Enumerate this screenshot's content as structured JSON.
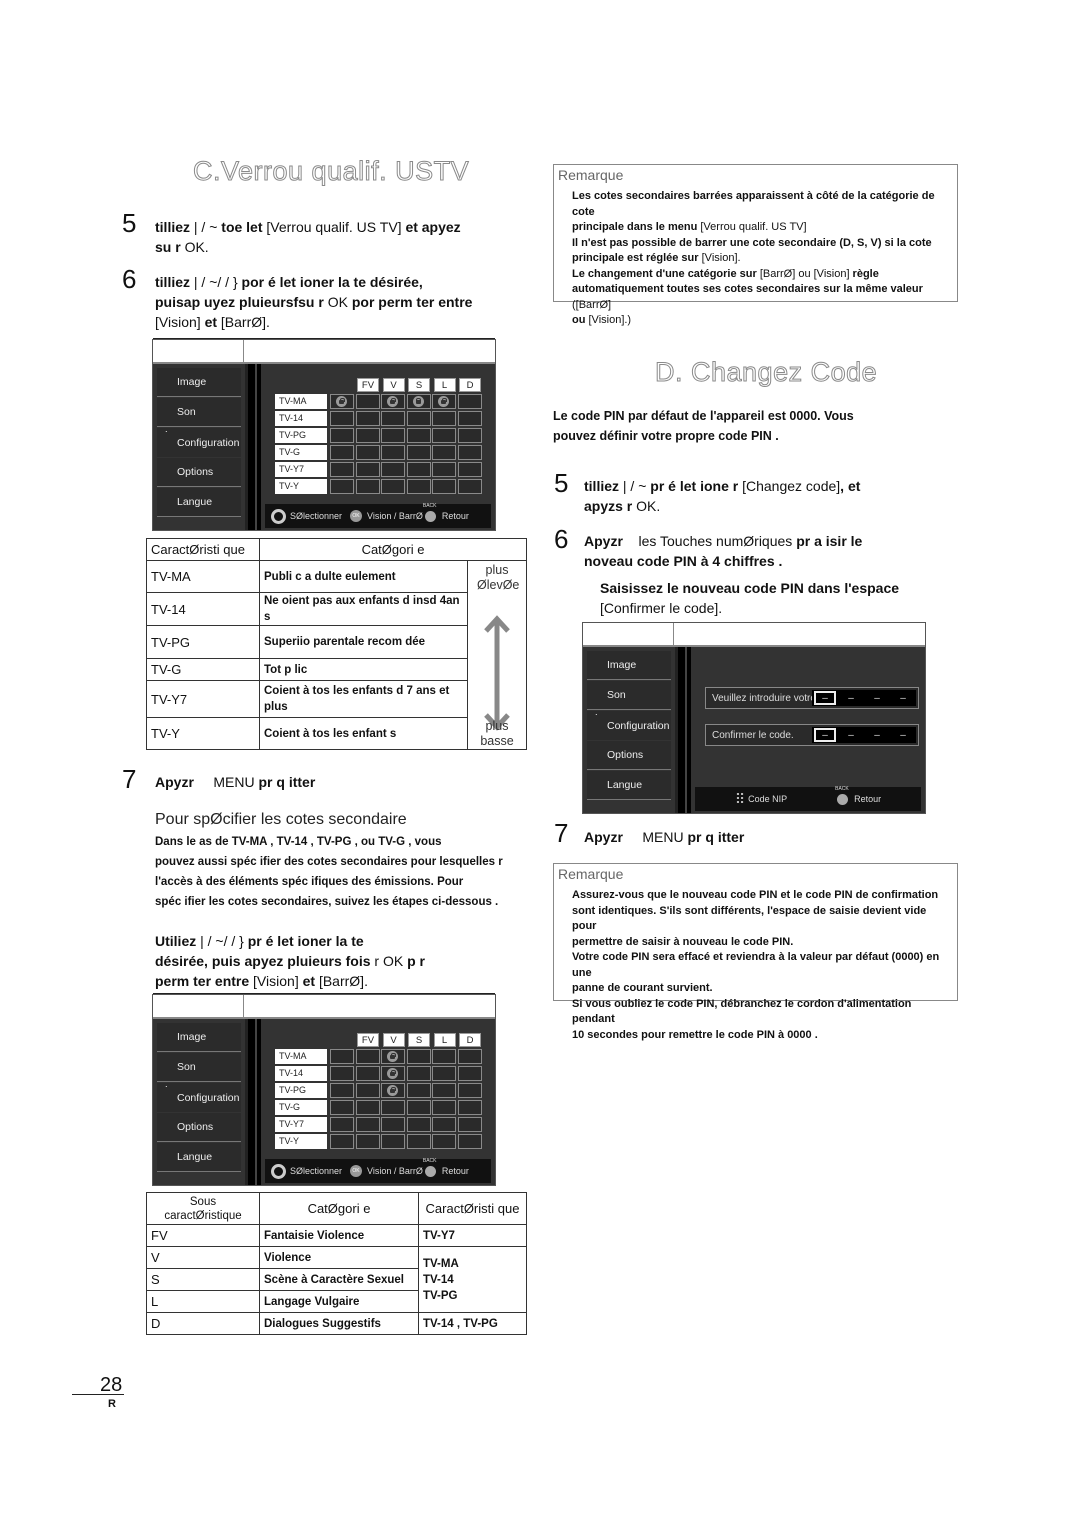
{
  "page": {
    "number": "28",
    "footer_letter": "R"
  },
  "section_c": {
    "title": "C.Verrou qualif. USTV",
    "step5": {
      "num": "5",
      "bold_a": "tilliez",
      "keys": "| / ~",
      "bold_b": "toe let",
      "bracket": "[Verrou qualif. US TV]",
      "bold_c": "et apyez",
      "line2_bold": "su r",
      "line2_reg": "OK."
    },
    "step6": {
      "num": "6",
      "line1_bold_a": "tilliez",
      "line1_keys": "| / ~/ / }",
      "line1_bold_b": "por é let ioner la te désirée,",
      "line2_bold": "puisap uyez pluieursfsu r",
      "line2_reg": "OK",
      "line2_bold_b": "por perm ter entre",
      "line3_reg_a": "[Vision]",
      "line3_bold": "et",
      "line3_reg_b": "[BarrØ]."
    },
    "screen1": {
      "menu": [
        "Image",
        "Son",
        "Configuration",
        "Options",
        "Langue"
      ],
      "selected_menu": "Configuration",
      "columns": [
        "FV",
        "V",
        "S",
        "L",
        "D"
      ],
      "rows": [
        "TV-MA",
        "TV-14",
        "TV-PG",
        "TV-G",
        "TV-Y7",
        "TV-Y"
      ],
      "locked": [
        [
          true,
          false,
          true,
          true,
          true,
          false
        ],
        [
          false,
          false,
          false,
          false,
          false,
          false
        ],
        [
          false,
          false,
          false,
          false,
          false,
          false
        ],
        [
          false,
          false,
          false,
          false,
          false,
          false
        ],
        [
          false,
          false,
          false,
          false,
          false,
          false
        ],
        [
          false,
          false,
          false,
          false,
          false,
          false
        ]
      ],
      "footer": {
        "select": "SØlectionner",
        "ok": "OK",
        "toggle": "Vision / BarrØ",
        "back": "Retour"
      }
    },
    "rating_table": {
      "headers": [
        "CaractØristi que",
        "CatØgori e"
      ],
      "rows": [
        {
          "rating": "TV-MA",
          "desc": "Publi c a dulte eulement"
        },
        {
          "rating": "TV-14",
          "desc": "Ne oient pas aux enfants d insd 4an s"
        },
        {
          "rating": "TV-PG",
          "desc": "Superiio parentale recom dée"
        },
        {
          "rating": "TV-G",
          "desc": "Tot p lic"
        },
        {
          "rating": "TV-Y7",
          "desc": "Coient à tos les enfants d 7 ans et plus"
        },
        {
          "rating": "TV-Y",
          "desc": "Coient à tos les enfant s"
        }
      ],
      "scale_top": "plus ØlevØe",
      "scale_bottom": "plus basse"
    },
    "step7": {
      "num": "7",
      "bold_a": "Apyzr",
      "reg": "MENU",
      "bold_b": "pr q itter"
    },
    "sub_heading": "Pour spØcifier les cotes secondaire",
    "sub_para": [
      "Dans le as de TV-MA , TV-14 , TV-PG , ou TV-G , vous",
      "pouvez aussi spéc ifier des cotes secondaires pour lesquelles r",
      "l'accès à des éléments spéc ifiques des émissions. Pour",
      "spéc ifier les cotes secondaires, suivez les étapes ci-dessous ."
    ],
    "sub_step": {
      "line1_bold_a": "Utiliez",
      "line1_keys": "| / ~/ / }",
      "line1_bold_b": "pr é let ioner la te",
      "line2_bold": "désirée, puis apyez pluieurs fois",
      "line2_reg": "r OK",
      "line2_bold_b": "p r",
      "line3_bold": "perm ter entre",
      "line3_reg_a": "[Vision]",
      "line3_bold_b": "et",
      "line3_reg_b": "[BarrØ]."
    },
    "screen2": {
      "menu": [
        "Image",
        "Son",
        "Configuration",
        "Options",
        "Langue"
      ],
      "selected_menu": "Configuration",
      "columns": [
        "FV",
        "V",
        "S",
        "L",
        "D"
      ],
      "rows": [
        "TV-MA",
        "TV-14",
        "TV-PG",
        "TV-G",
        "TV-Y7",
        "TV-Y"
      ],
      "locked": [
        [
          false,
          false,
          true,
          false,
          false,
          false
        ],
        [
          false,
          false,
          true,
          false,
          false,
          false
        ],
        [
          false,
          false,
          true,
          false,
          false,
          false
        ],
        [
          false,
          false,
          false,
          false,
          false,
          false
        ],
        [
          false,
          false,
          false,
          false,
          false,
          false
        ],
        [
          false,
          false,
          false,
          false,
          false,
          false
        ]
      ],
      "footer": {
        "select": "SØlectionner",
        "ok": "OK",
        "toggle": "Vision / BarrØ",
        "back": "Retour"
      }
    },
    "sub_table": {
      "headers": [
        "Sous caractØristique",
        "CatØgori e",
        "CaractØristi que"
      ],
      "rows": [
        {
          "code": "FV",
          "category": "Fantaisie Violence",
          "ratings": "TV-Y7"
        },
        {
          "code": "V",
          "category": "Violence",
          "ratings": "TV-MA / TV-14 / TV-PG"
        },
        {
          "code": "S",
          "category": "Scène à Caractère Sexuel",
          "ratings": ""
        },
        {
          "code": "L",
          "category": "Langage Vulgaire",
          "ratings": ""
        },
        {
          "code": "D",
          "category": "Dialogues Suggestifs",
          "ratings": "TV-14 , TV-PG"
        }
      ],
      "merged_ratings_lines": [
        "TV-MA",
        "TV-14",
        "TV-PG"
      ]
    }
  },
  "remark1": {
    "title": "Remarque",
    "lines": [
      {
        "bold": "Les cotes secondaires barrées apparaissent à côté de la catégorie de cote",
        "reg": ""
      },
      {
        "bold": "principale dans le menu",
        "reg": "[Verrou qualif. US TV]"
      },
      {
        "bold": "Il n'est pas possible de barrer une cote secondaire (D, S, V) si la cote",
        "reg": ""
      },
      {
        "bold": "principale est réglée sur",
        "reg": "[Vision]."
      },
      {
        "bold": "Le changement d'une catégorie sur",
        "reg": "[BarrØ] ou [Vision]",
        "bold_b": "règle"
      },
      {
        "bold": "automatiquement toutes ses cotes secondaires sur la même valeur",
        "reg": "([BarrØ]"
      },
      {
        "bold": "ou",
        "reg": "[Vision].)"
      }
    ]
  },
  "section_d": {
    "title": "D. Changez Code",
    "intro": [
      "Le code PIN par défaut de l'appareil est 0000. Vous",
      "pouvez définir votre propre code PIN ."
    ],
    "step5": {
      "num": "5",
      "bold_a": "tilliez",
      "keys": "| / ~",
      "bold_b": "pr é let ione r",
      "bracket": "[Changez code]",
      "bold_c": ", et",
      "line2_bold": "apyzs r",
      "line2_reg": "OK."
    },
    "step6": {
      "num": "6",
      "bold_a": "Apyzr",
      "reg": "les Touches numØriques",
      "bold_b": "pr a isir le",
      "line2_bold": "noveau code PIN à 4 chiffres ."
    },
    "step6_sub": {
      "bold": "Saisissez le nouveau code PIN dans l'espace",
      "reg": "[Confirmer le code]."
    },
    "screen3": {
      "menu": [
        "Image",
        "Son",
        "Configuration",
        "Options",
        "Langue"
      ],
      "selected_menu": "Configuration",
      "field1_label": "Veuillez introduire votre code.",
      "field2_label": "Confirmer le code.",
      "slot_placeholder": "–",
      "footer": {
        "pin": "Code NIP",
        "back": "Retour"
      }
    },
    "step7": {
      "num": "7",
      "bold_a": "Apyzr",
      "reg": "MENU",
      "bold_b": "pr q itter"
    }
  },
  "remark2": {
    "title": "Remarque",
    "lines": [
      "Assurez-vous que le nouveau code PIN et le code PIN de confirmation",
      "sont identiques. S'ils sont différents, l'espace de saisie devient vide pour",
      "permettre de saisir à nouveau le code PIN.",
      "Votre code PIN sera effacé et reviendra à la valeur par défaut (0000) en une",
      "panne de courant survient.",
      "Si vous oubliez le code PIN, débranchez le cordon d'alimentation pendant",
      "10 secondes pour remettre le code PIN à 0000 ."
    ]
  }
}
